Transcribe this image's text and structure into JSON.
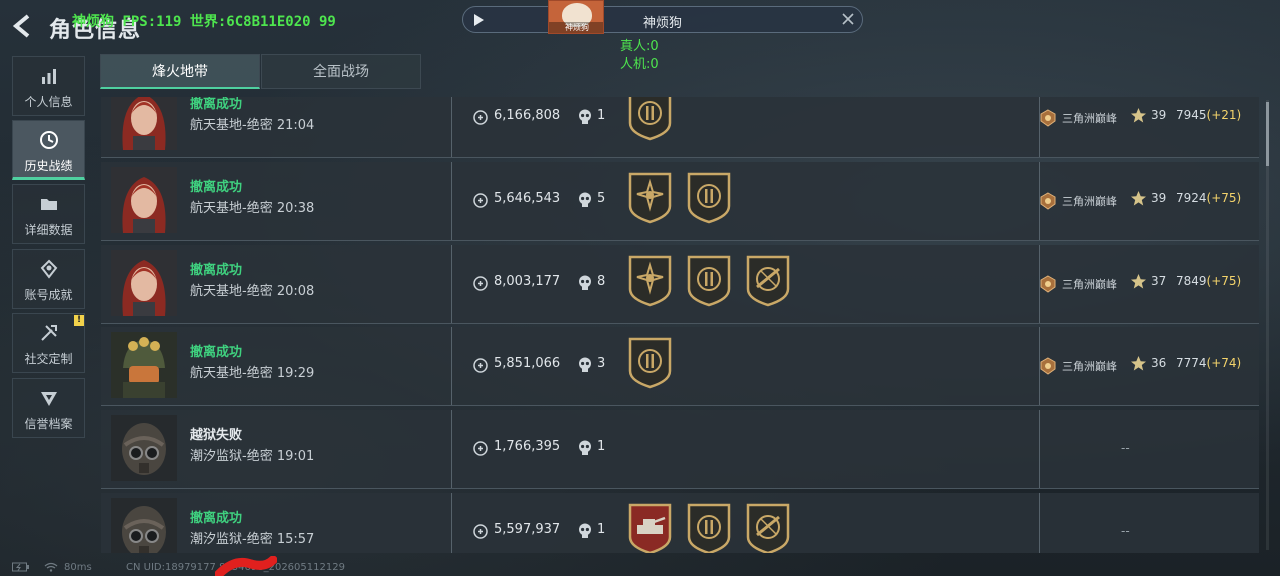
{
  "header": {
    "title": "角色信息",
    "debug_overlay": "神烦狗 FPS:119 世界:6C8B11E020 99"
  },
  "top_pill": {
    "name": "神烦狗",
    "avatar_label": "神烦狗",
    "real_players": "真人:0",
    "bots": "人机:0"
  },
  "sidebar": {
    "items": [
      {
        "label": "个人信息",
        "icon": "bar-chart-icon"
      },
      {
        "label": "历史战绩",
        "icon": "clock-icon"
      },
      {
        "label": "详细数据",
        "icon": "folder-icon"
      },
      {
        "label": "账号成就",
        "icon": "achievement-icon"
      },
      {
        "label": "社交定制",
        "icon": "tools-icon"
      },
      {
        "label": "信誉档案",
        "icon": "shield-icon"
      }
    ],
    "active_index": 1,
    "badge": "!"
  },
  "tabs": [
    {
      "label": "烽火地带"
    },
    {
      "label": "全面战场"
    }
  ],
  "matches": [
    {
      "status": "撤离成功",
      "result": "ok",
      "map": "航天基地-绝密 21:04",
      "value": "6,166,808",
      "kills": "1",
      "portrait": "red-hair",
      "medals": [
        "sun"
      ],
      "rank": "三角洲巅峰",
      "level": "39",
      "score": "7945",
      "delta": "(+21)"
    },
    {
      "status": "撤离成功",
      "result": "ok",
      "map": "航天基地-绝密 20:38",
      "value": "5,646,543",
      "kills": "5",
      "portrait": "red-hair",
      "medals": [
        "star",
        "sun"
      ],
      "rank": "三角洲巅峰",
      "level": "39",
      "score": "7924",
      "delta": "(+75)"
    },
    {
      "status": "撤离成功",
      "result": "ok",
      "map": "航天基地-绝密 20:08",
      "value": "8,003,177",
      "kills": "8",
      "portrait": "red-hair",
      "medals": [
        "star",
        "sun",
        "rifle"
      ],
      "rank": "三角洲巅峰",
      "level": "37",
      "score": "7849",
      "delta": "(+75)"
    },
    {
      "status": "撤离成功",
      "result": "ok",
      "map": "航天基地-绝密 19:29",
      "value": "5,851,066",
      "kills": "3",
      "portrait": "gold-helmet",
      "medals": [
        "sun"
      ],
      "rank": "三角洲巅峰",
      "level": "36",
      "score": "7774",
      "delta": "(+74)"
    },
    {
      "status": "越狱失败",
      "result": "fail",
      "map": "潮汐监狱-绝密 19:01",
      "value": "1,766,395",
      "kills": "1",
      "portrait": "gas-mask",
      "medals": [],
      "rank": "",
      "level": "",
      "score": "",
      "delta": "",
      "no_rank": "--"
    },
    {
      "status": "撤离成功",
      "result": "ok",
      "map": "潮汐监狱-绝密 15:57",
      "value": "5,597,937",
      "kills": "1",
      "portrait": "gas-mask",
      "medals": [
        "tank",
        "sun",
        "rifle"
      ],
      "rank": "",
      "level": "",
      "score": "",
      "delta": "",
      "no_rank": "--"
    }
  ],
  "bottom_bar": {
    "ping": "80ms",
    "uid": "CN UID:18979177  8134698_202605112129"
  },
  "colors": {
    "accent": "#4fd0a0",
    "success": "#3fd17f",
    "fps_overlay": "#4ee54e",
    "delta": "#f3d36b",
    "medal_gold": "#c9a867"
  }
}
